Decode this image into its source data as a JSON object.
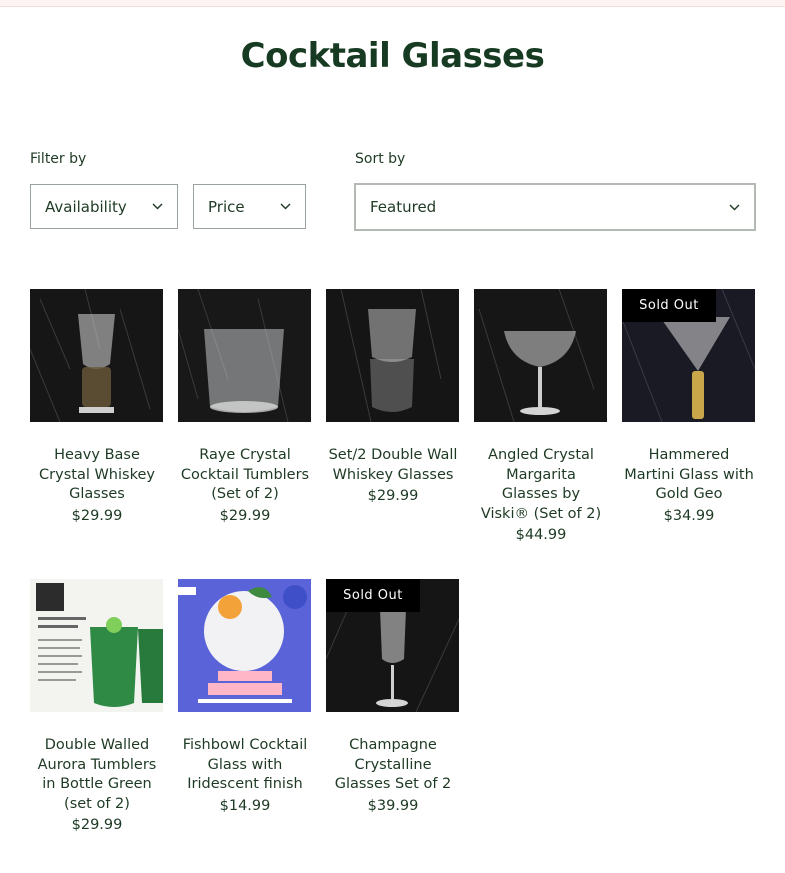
{
  "page": {
    "title": "Cocktail Glasses"
  },
  "filters": {
    "label": "Filter by",
    "availability": "Availability",
    "price": "Price",
    "icon": "chevron-down-icon"
  },
  "sort": {
    "label": "Sort by",
    "selected": "Featured"
  },
  "products": [
    {
      "name": "Heavy Base Crystal Whiskey Glasses",
      "price": "$29.99"
    },
    {
      "name": "Raye Crystal Cocktail Tumblers (Set of 2)",
      "price": "$29.99"
    },
    {
      "name": "Set/2 Double Wall Whiskey Glasses",
      "price": "$29.99"
    },
    {
      "name": "Angled Crystal Margarita Glasses by Viski® (Set of 2)",
      "price": "$44.99"
    },
    {
      "name": "Hammered Martini Glass with Gold Geo",
      "price": "$34.99",
      "badge": "Sold Out"
    },
    {
      "name": "Double Walled Aurora Tumblers in Bottle Green (set of 2)",
      "price": "$29.99"
    },
    {
      "name": "Fishbowl Cocktail Glass with Iridescent finish",
      "price": "$14.99"
    },
    {
      "name": "Champagne Crystalline Glasses Set of 2",
      "price": "$39.99",
      "badge": "Sold Out"
    }
  ],
  "colors": {
    "heading": "#173b22",
    "text": "#1e3a24",
    "badge_bg": "#000000"
  }
}
